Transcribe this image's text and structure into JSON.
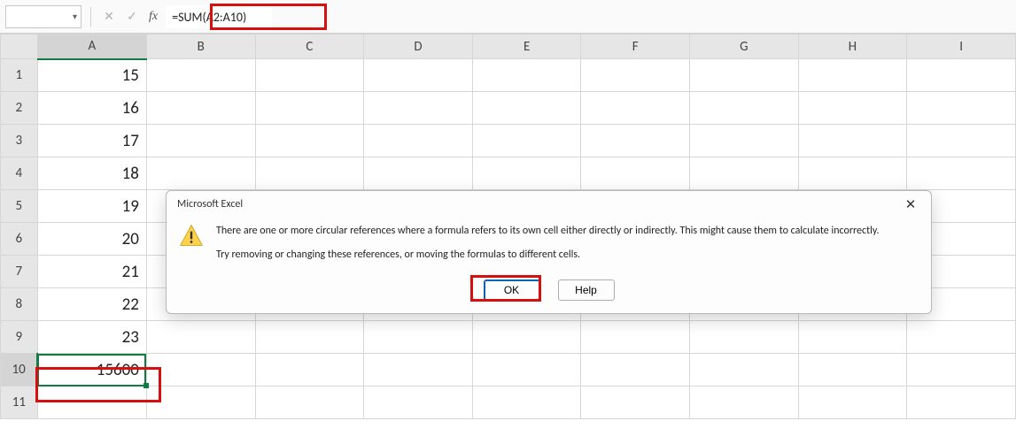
{
  "formula_bar": {
    "name_box_value": "",
    "fx_label": "fx",
    "formula": "=SUM(A2:A10)"
  },
  "columns": [
    "A",
    "B",
    "C",
    "D",
    "E",
    "F",
    "G",
    "H",
    "I"
  ],
  "rows": [
    1,
    2,
    3,
    4,
    5,
    6,
    7,
    8,
    9,
    10,
    11
  ],
  "selected_column_index": 0,
  "selected_row_index": 9,
  "cells": {
    "col_a": [
      "15",
      "16",
      "17",
      "18",
      "19",
      "20",
      "21",
      "22",
      "23",
      "15600",
      ""
    ]
  },
  "dialog": {
    "title": "Microsoft Excel",
    "line1": "There are one or more circular references where a formula refers to its own cell either directly or indirectly. This might cause them to calculate incorrectly.",
    "line2": "Try removing or changing these references, or moving the formulas to different cells.",
    "ok_label": "OK",
    "help_label": "Help"
  }
}
